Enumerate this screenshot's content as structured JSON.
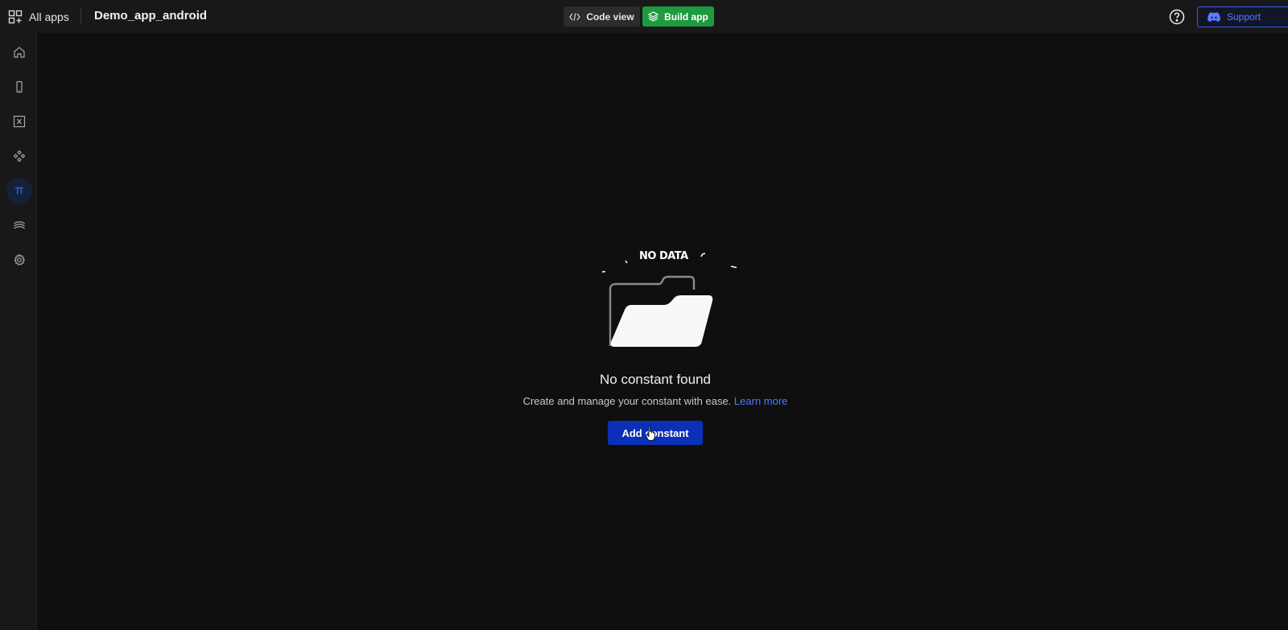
{
  "header": {
    "all_apps_label": "All apps",
    "app_title": "Demo_app_android",
    "code_view_label": "Code view",
    "build_app_label": "Build app",
    "support_label": "Support"
  },
  "sidebar": {
    "items": [
      {
        "name": "home",
        "icon": "home-icon",
        "active": false
      },
      {
        "name": "screens",
        "icon": "mobile-icon",
        "active": false
      },
      {
        "name": "variables",
        "icon": "variable-icon",
        "active": false
      },
      {
        "name": "components",
        "icon": "components-icon",
        "active": false
      },
      {
        "name": "constants",
        "icon": "pi-icon",
        "active": true
      },
      {
        "name": "api",
        "icon": "api-icon",
        "active": false
      },
      {
        "name": "settings",
        "icon": "gear-icon",
        "active": false
      }
    ]
  },
  "empty_state": {
    "illustration_text": "NO DATA",
    "title": "No constant found",
    "description": "Create and manage your constant with ease.",
    "learn_more_label": "Learn more",
    "add_button_label": "Add constant"
  },
  "colors": {
    "background": "#0f0f0f",
    "panel": "#181818",
    "build_green": "#1f9a3f",
    "primary_blue": "#0c2fb8",
    "link_blue": "#4f7cff"
  }
}
